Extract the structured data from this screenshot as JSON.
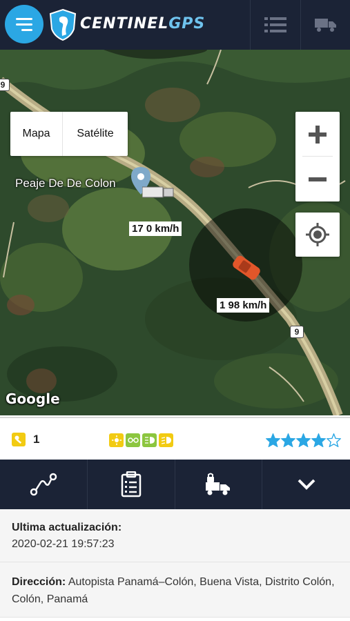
{
  "header": {
    "logo_text_main": "CENTINEL",
    "logo_text_accent": "GPS",
    "menu_icon": "hamburger-icon",
    "list_icon": "list-icon",
    "truck_icon": "truck-icon"
  },
  "map": {
    "map_type_options": [
      "Mapa",
      "Satélite"
    ],
    "zoom_in": "+",
    "zoom_out": "−",
    "place_label": "Peaje De De Colon",
    "speed_label_1": "17 0 km/h",
    "speed_label_2": "1 98 km/h",
    "route_shield": "9",
    "attribution": "Google"
  },
  "info_bar": {
    "key_count": "1",
    "rating": 4,
    "rating_max": 5,
    "status_icon_colors": [
      "#f2cb12",
      "#8cc63f",
      "#8cc63f",
      "#f2cb12"
    ]
  },
  "actions": [
    "route-icon",
    "clipboard-icon",
    "lock-truck-icon",
    "chevron-down-icon"
  ],
  "details": {
    "last_update_label": "Ultima actualización:",
    "last_update_value": "2020-02-21 19:57:23",
    "address_label": "Dirección:",
    "address_value": "Autopista Panamá–Colón, Buena Vista, Distrito Colón, Colón, Panamá"
  },
  "colors": {
    "header_bg": "#1b2336",
    "accent": "#2ba7e4",
    "star": "#2ba7e4"
  }
}
